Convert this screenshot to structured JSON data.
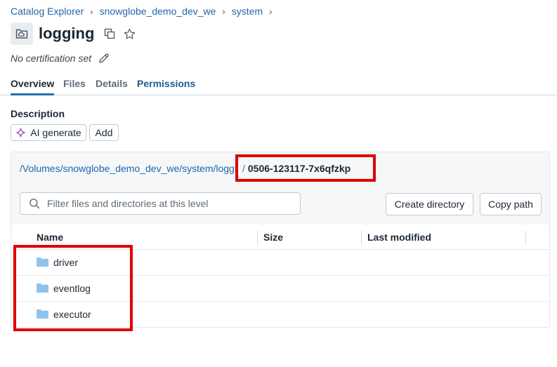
{
  "breadcrumb": {
    "items": [
      "Catalog Explorer",
      "snowglobe_demo_dev_we",
      "system"
    ],
    "separator": "›"
  },
  "header": {
    "title": "logging",
    "certification": "No certification set"
  },
  "tabs": [
    {
      "label": "Overview",
      "active": true
    },
    {
      "label": "Files",
      "active": false
    },
    {
      "label": "Details",
      "active": false
    },
    {
      "label": "Permissions",
      "active": false
    }
  ],
  "description": {
    "label": "Description",
    "ai_generate_label": "AI generate",
    "add_label": "Add"
  },
  "browser": {
    "path_base": "/Volumes/snowglobe_demo_dev_we/system/logging",
    "path_separator": "/",
    "path_current": "0506-123117-7x6qfzkp",
    "filter_placeholder": "Filter files and directories at this level",
    "create_directory_label": "Create directory",
    "copy_path_label": "Copy path",
    "columns": [
      "Name",
      "Size",
      "Last modified"
    ],
    "rows": [
      {
        "name": "driver",
        "size": "",
        "modified": ""
      },
      {
        "name": "eventlog",
        "size": "",
        "modified": ""
      },
      {
        "name": "executor",
        "size": "",
        "modified": ""
      }
    ]
  },
  "colors": {
    "link": "#2266aa",
    "accent_tab": "#2272b4",
    "folder": "#8fc3ee",
    "highlight": "#e00000"
  }
}
